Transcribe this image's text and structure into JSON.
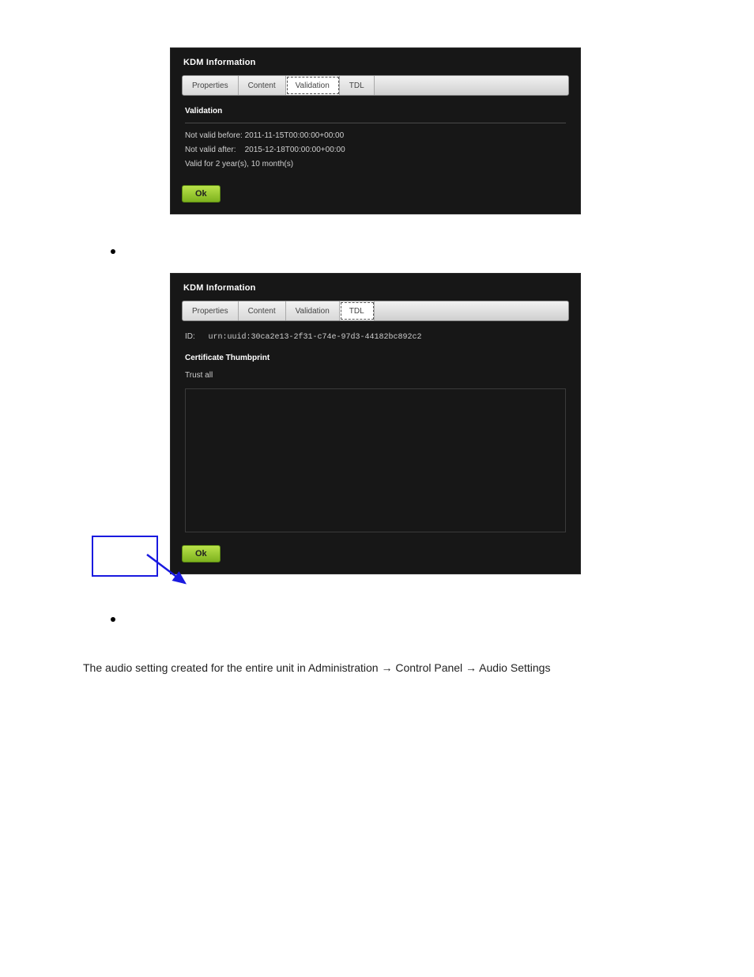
{
  "dialog1": {
    "title": "KDM Information",
    "tabs": [
      "Properties",
      "Content",
      "Validation",
      "TDL"
    ],
    "active_tab": "Validation",
    "section_title": "Validation",
    "rows": [
      {
        "label": "Not valid before:",
        "value": "2011-11-15T00:00:00+00:00"
      },
      {
        "label": "Not valid after:",
        "value": "2015-12-18T00:00:00+00:00"
      }
    ],
    "summary": "Valid for 2 year(s), 10 month(s)",
    "ok_label": "Ok"
  },
  "bullets": [
    "",
    ""
  ],
  "dialog2": {
    "title": "KDM Information",
    "tabs": [
      "Properties",
      "Content",
      "Validation",
      "TDL"
    ],
    "active_tab": "TDL",
    "id_label": "ID:",
    "id_value": "urn:uuid:30ca2e13-2f31-c74e-97d3-44182bc892c2",
    "cert_title": "Certificate Thumbprint",
    "trust_text": "Trust all",
    "ok_label": "Ok"
  },
  "note_text": "The audio setting created for the entire unit in Administration → Control Panel → Audio Settings"
}
